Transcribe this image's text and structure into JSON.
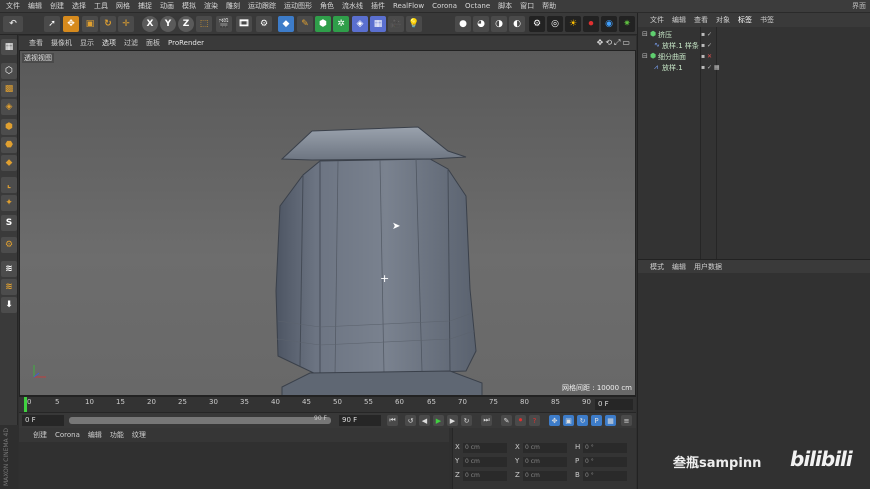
{
  "menubar": {
    "items": [
      "文件",
      "编辑",
      "创建",
      "选择",
      "工具",
      "网格",
      "捕捉",
      "动画",
      "模拟",
      "渲染",
      "雕刻",
      "运动跟踪",
      "运动图形",
      "角色",
      "流水线",
      "插件",
      "RealFlow",
      "Corona",
      "Octane",
      "脚本",
      "窗口",
      "帮助"
    ],
    "right_label": "界面"
  },
  "toolbar": {
    "axis_x": "X",
    "axis_y": "Y",
    "axis_z": "Z"
  },
  "viewport": {
    "menu_items": [
      "查看",
      "摄像机",
      "显示",
      "选项",
      "过滤",
      "面板"
    ],
    "prorender": "ProRender",
    "view_name": "透视视图",
    "grid_info": "网格间距 : 10000 cm"
  },
  "timeline": {
    "ticks": [
      "0",
      "5",
      "10",
      "15",
      "20",
      "25",
      "30",
      "35",
      "40",
      "45",
      "50",
      "55",
      "60",
      "65",
      "70",
      "75",
      "80",
      "85",
      "90"
    ],
    "end_field": "0 F"
  },
  "playbar": {
    "start_field": "0 F",
    "slider_label": "90 F",
    "end_field": "90 F",
    "slider_fraction": 1.0,
    "slider_left_label": "0"
  },
  "material_menu": {
    "items": [
      "创建",
      "Corona",
      "编辑",
      "功能",
      "纹理"
    ]
  },
  "coords": {
    "rows": [
      {
        "a": "X",
        "av": "0 cm",
        "b": "X",
        "bv": "0 cm",
        "c": "H",
        "cv": "0 °"
      },
      {
        "a": "Y",
        "av": "0 cm",
        "b": "Y",
        "bv": "0 cm",
        "c": "P",
        "cv": "0 °"
      },
      {
        "a": "Z",
        "av": "0 cm",
        "b": "Z",
        "bv": "0 cm",
        "c": "B",
        "cv": "0 °"
      }
    ]
  },
  "object_manager": {
    "menu_items": [
      "文件",
      "编辑",
      "查看",
      "对象",
      "标签",
      "书签"
    ],
    "objects": [
      {
        "name": "挤压"
      },
      {
        "name": "放样.1 样条"
      },
      {
        "name": "细分曲面"
      },
      {
        "name": "放样.1"
      }
    ]
  },
  "attribute_manager": {
    "menu_items": [
      "模式",
      "编辑",
      "用户数据"
    ]
  },
  "watermark": {
    "text": "叁瓶sampinn",
    "logo": "bilibili"
  },
  "colors": {
    "accent_green": "#40d040",
    "panel_bg": "#333333",
    "viewport_bg": "#616161"
  }
}
